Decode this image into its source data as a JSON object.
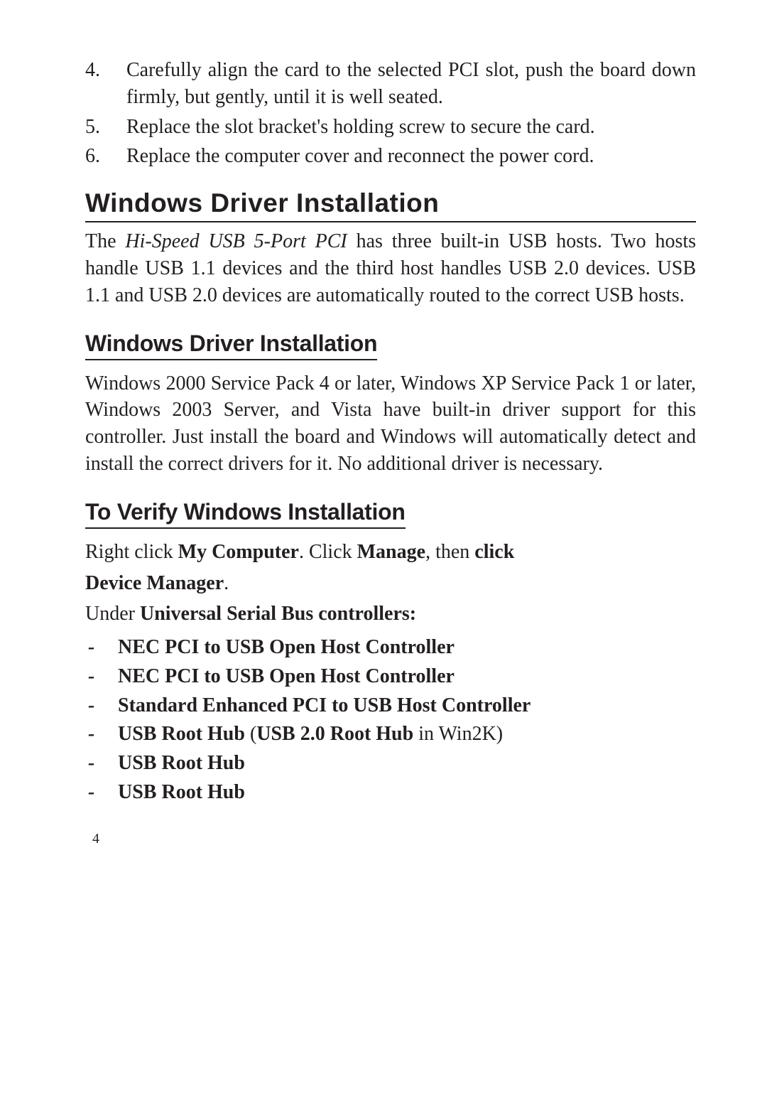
{
  "steps": [
    {
      "num": "4.",
      "text": "Carefully align the card to the selected PCI slot, push the board down firmly, but gently, until it is well seated."
    },
    {
      "num": "5.",
      "text": "Replace the slot bracket's holding screw to secure the card."
    },
    {
      "num": "6.",
      "text": "Replace the computer cover and reconnect the power cord."
    }
  ],
  "section1": {
    "title": "Windows  Driver  Installation",
    "para_pre": "The ",
    "para_italic": "Hi-Speed USB 5-Port PCI",
    "para_post": " has three built-in USB hosts. Two hosts handle USB 1.1 devices and the third host handles USB 2.0 devices.  USB 1.1 and USB 2.0 devices are automatically routed to the correct USB hosts."
  },
  "section2": {
    "title": "Windows Driver Installation",
    "para": "Windows 2000 Service Pack 4 or later, Windows XP Service Pack 1 or later, Windows 2003 Server, and Vista have built-in driver support for this controller.  Just install the board and Windows will automatically detect and install the correct drivers for it.  No additional driver is necessary."
  },
  "section3": {
    "title": "To Verify Windows Installation",
    "p1_a": "Right click ",
    "p1_b": "My Computer",
    "p1_c": ".  Click ",
    "p1_d": "Manage",
    "p1_e": ", then ",
    "p1_f": "click",
    "p2_a": "Device Manager",
    "p2_b": ".",
    "p3_a": "Under ",
    "p3_b": "Universal Serial Bus controllers:",
    "bullets": [
      {
        "bold": "NEC PCI to USB Open Host Controller",
        "tail": ""
      },
      {
        "bold": "NEC PCI to USB Open Host Controller",
        "tail": ""
      },
      {
        "bold": "Standard Enhanced PCI to USB Host Controller",
        "tail": ""
      },
      {
        "bold": "USB Root Hub",
        "mid": " (",
        "bold2": "USB 2.0 Root Hub",
        "tail": " in Win2K)"
      },
      {
        "bold": "USB Root Hub",
        "tail": ""
      },
      {
        "bold": "USB Root Hub",
        "tail": ""
      }
    ]
  },
  "page_number": "4",
  "dash": "-"
}
